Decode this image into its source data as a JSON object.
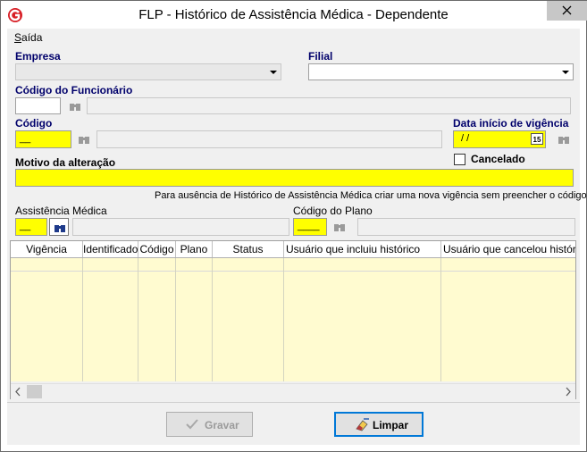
{
  "window": {
    "title": "FLP - Histórico de Assistência Médica - Dependente"
  },
  "menu": {
    "saida": "Saída"
  },
  "form": {
    "empresa_label": "Empresa",
    "filial_label": "Filial",
    "codigo_funcionario_label": "Código do Funcionário",
    "codigo_label": "Código",
    "codigo_value": "__",
    "data_inicio_label": "Data início de vigência",
    "data_inicio_value": " /  /",
    "cal_icon_text": "15",
    "motivo_label": "Motivo da alteração",
    "cancelado_label": "Cancelado",
    "info_text": "Para ausência de Histórico de Assistência Médica criar uma nova vigência sem preencher o código",
    "assistencia_label": "Assistência Médica",
    "assistencia_value": "__",
    "codigo_plano_label": "Código do Plano",
    "codigo_plano_value": "____"
  },
  "grid": {
    "columns": [
      "Vigência",
      "Identificador",
      "Código",
      "Plano",
      "Status",
      "Usuário que incluiu histórico",
      "Usuário que cancelou histórico"
    ]
  },
  "buttons": {
    "gravar": "Gravar",
    "limpar": "Limpar"
  },
  "colors": {
    "required_field": "#ffff00",
    "label_blue": "#00006b",
    "grid_body": "#fffbd0",
    "close_button": "#c7c7c7"
  },
  "icons": {
    "app": "red-g-logo-icon",
    "close": "close-icon",
    "search": "binoculars-icon",
    "calendar": "calendar-icon",
    "gravar": "checkmark-icon",
    "limpar": "eraser-icon"
  }
}
